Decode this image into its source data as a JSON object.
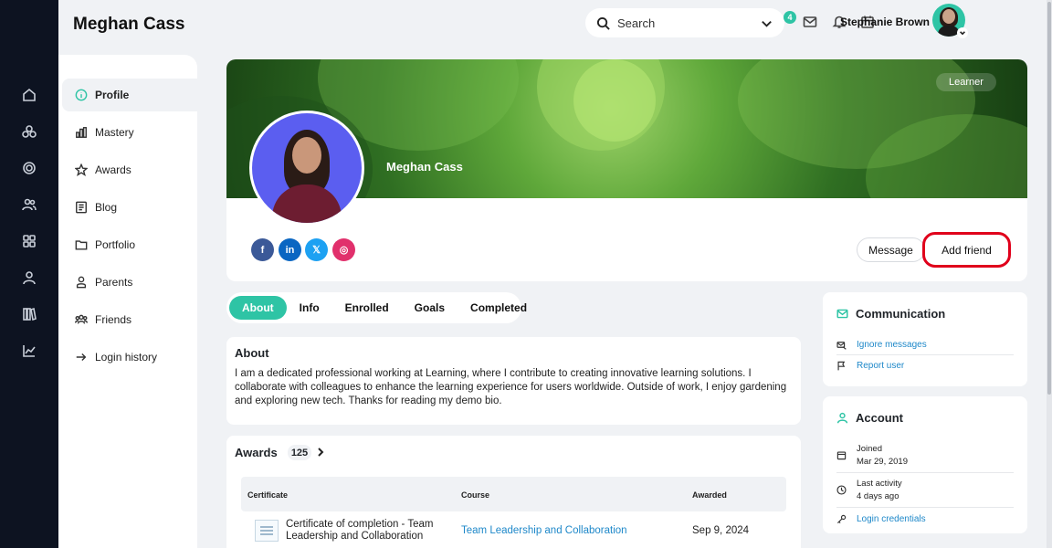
{
  "header": {
    "title": "Meghan Cass",
    "search_placeholder": "Search",
    "notification_count": "4",
    "user_name": "Stephanie Brown"
  },
  "rail": {
    "icons": [
      "home-icon",
      "groups-icon",
      "target-icon",
      "people-icon",
      "apps-icon",
      "user-icon",
      "library-icon",
      "chart-icon"
    ]
  },
  "menu": {
    "items": [
      {
        "label": "Profile",
        "icon": "info-icon"
      },
      {
        "label": "Mastery",
        "icon": "bar-chart-icon"
      },
      {
        "label": "Awards",
        "icon": "star-icon"
      },
      {
        "label": "Blog",
        "icon": "blog-icon"
      },
      {
        "label": "Portfolio",
        "icon": "folder-icon"
      },
      {
        "label": "Parents",
        "icon": "parent-icon"
      },
      {
        "label": "Friends",
        "icon": "friends-icon"
      },
      {
        "label": "Login history",
        "icon": "login-icon"
      }
    ]
  },
  "profile": {
    "role": "Learner",
    "name": "Meghan Cass",
    "social": [
      "f",
      "in",
      "𝕏",
      "◎"
    ],
    "social_colors": [
      "#3b5998",
      "#0a66c2",
      "#1da1f2",
      "#e1306c"
    ],
    "message_label": "Message",
    "add_friend_label": "Add friend"
  },
  "tabs": [
    {
      "label": "About"
    },
    {
      "label": "Info"
    },
    {
      "label": "Enrolled"
    },
    {
      "label": "Goals"
    },
    {
      "label": "Completed"
    }
  ],
  "about": {
    "title": "About",
    "text": "I am a dedicated professional working at Learning, where I contribute to creating innovative learning solutions. I collaborate with colleagues to enhance the learning experience for users worldwide. Outside of work, I enjoy gardening and exploring new tech. Thanks for reading my demo bio."
  },
  "awards": {
    "title": "Awards",
    "count": "125",
    "columns": {
      "certificate": "Certificate",
      "course": "Course",
      "awarded": "Awarded"
    },
    "rows": [
      {
        "certificate": "Certificate of completion - Team Leadership and Collaboration",
        "course": "Team Leadership and Collaboration",
        "awarded": "Sep 9, 2024"
      }
    ]
  },
  "communication": {
    "title": "Communication",
    "items": [
      "Ignore messages",
      "Report user"
    ]
  },
  "account": {
    "title": "Account",
    "joined_label": "Joined",
    "joined_value": "Mar 29, 2019",
    "activity_label": "Last activity",
    "activity_value": "4 days ago",
    "credentials": "Login credentials"
  },
  "colors": {
    "accent": "#2ec4a5",
    "link": "#1e88c9",
    "highlight": "#e0001b",
    "rail": "#0d1321"
  }
}
